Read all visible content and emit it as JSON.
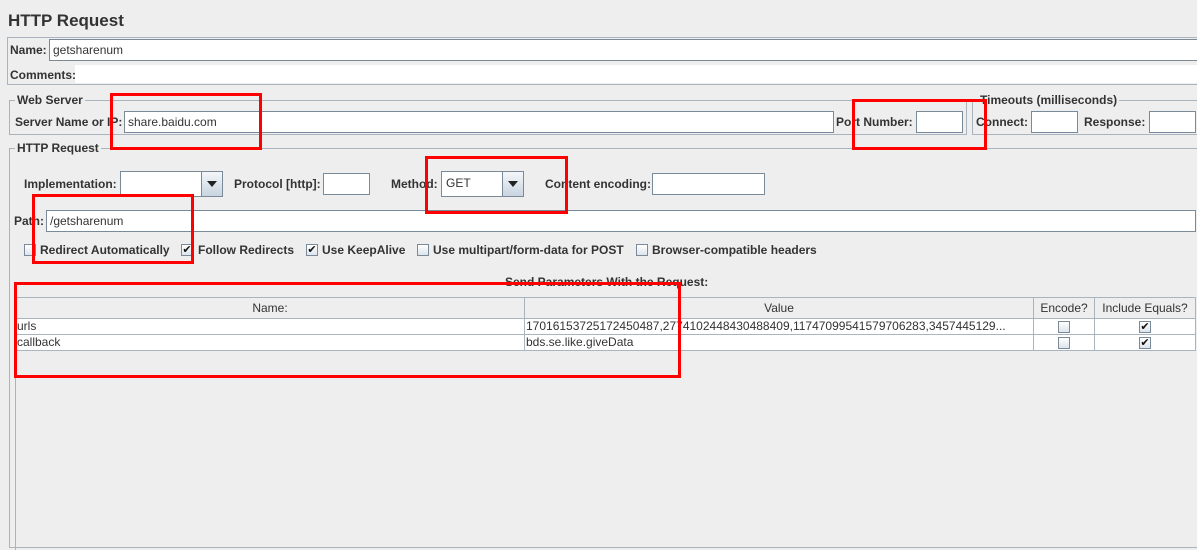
{
  "title": "HTTP Request",
  "name": {
    "label": "Name:",
    "value": "getsharenum"
  },
  "comments": {
    "label": "Comments:",
    "value": ""
  },
  "web_server": {
    "title": "Web Server",
    "server_label": "Server Name or IP:",
    "server_value": "share.baidu.com",
    "port_label": "Port Number:",
    "port_value": ""
  },
  "timeouts": {
    "title": "Timeouts (milliseconds)",
    "connect_label": "Connect:",
    "connect_value": "",
    "response_label": "Response:",
    "response_value": ""
  },
  "http_request": {
    "title": "HTTP Request",
    "implementation_label": "Implementation:",
    "implementation_value": "",
    "protocol_label": "Protocol [http]:",
    "protocol_value": "",
    "method_label": "Method:",
    "method_value": "GET",
    "encoding_label": "Content encoding:",
    "encoding_value": "",
    "path_label": "Path:",
    "path_value": "/getsharenum"
  },
  "options": [
    {
      "label": "Redirect Automatically",
      "checked": false
    },
    {
      "label": "Follow Redirects",
      "checked": true
    },
    {
      "label": "Use KeepAlive",
      "checked": true
    },
    {
      "label": "Use multipart/form-data for POST",
      "checked": false
    },
    {
      "label": "Browser-compatible headers",
      "checked": false
    }
  ],
  "params": {
    "title": "Send Parameters With the Request:",
    "columns": [
      "Name:",
      "Value",
      "Encode?",
      "Include Equals?"
    ],
    "rows": [
      {
        "name": "urls",
        "value": "17016153725172450487,2774102448430488409,11747099541579706283,3457445129...",
        "encode": false,
        "include_equals": true
      },
      {
        "name": "callback",
        "value": "bds.se.like.giveData",
        "encode": false,
        "include_equals": true
      }
    ]
  },
  "highlight_color": "#ff0000"
}
